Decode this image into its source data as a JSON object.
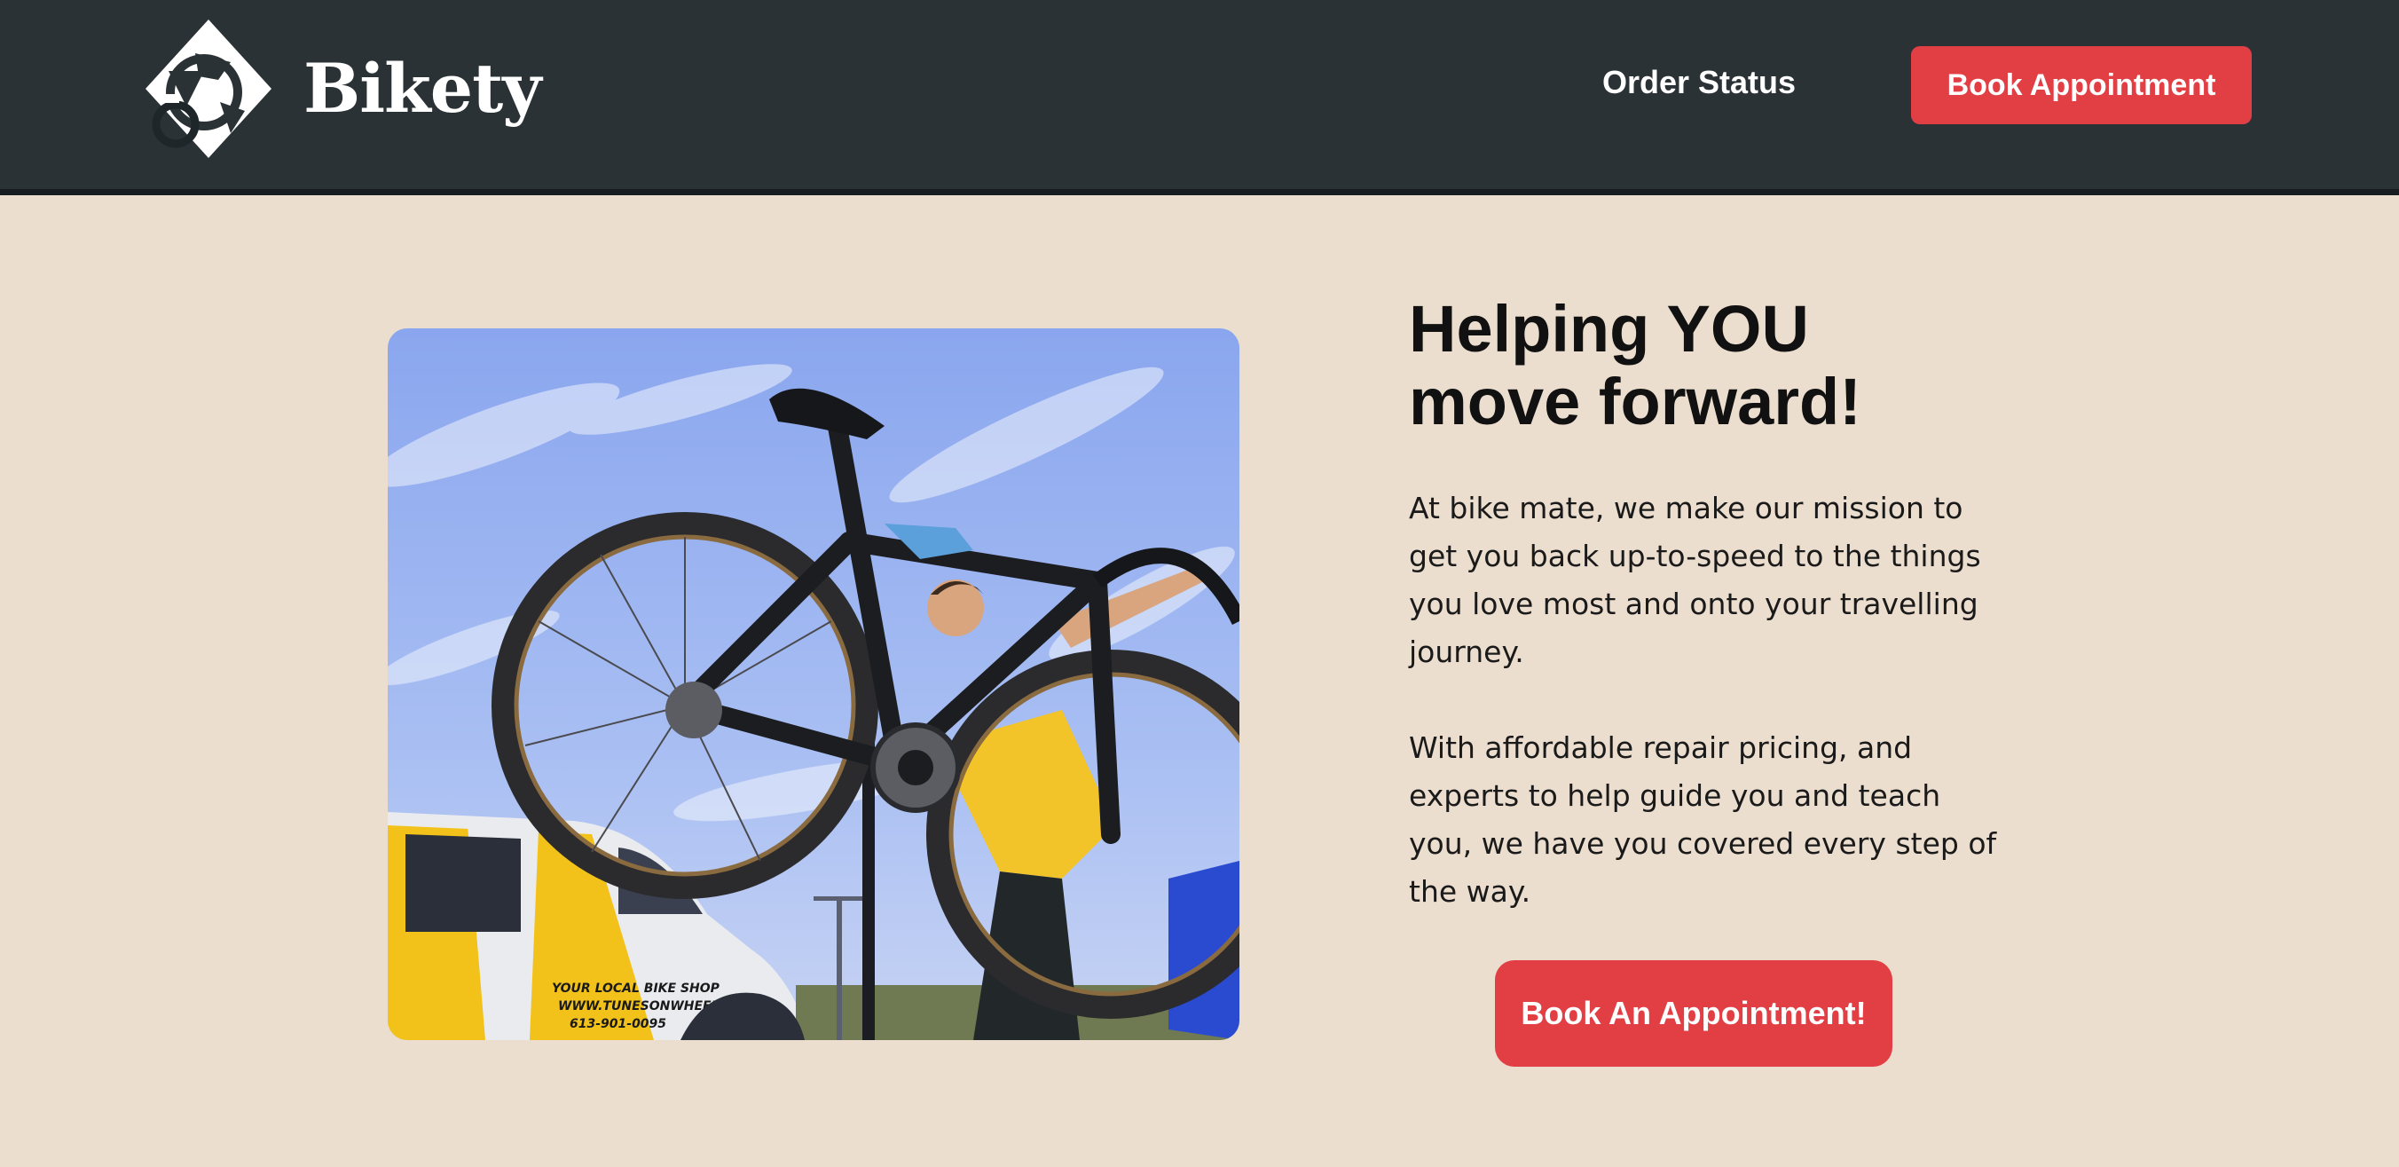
{
  "header": {
    "brand": "Bikety",
    "logo_icon": "bike-logo-icon",
    "nav_order_status": "Order Status",
    "nav_book": "Book Appointment"
  },
  "hero": {
    "title_line1": "Helping YOU",
    "title_line2": "move forward!",
    "para1_lines": [
      "At bike mate, we make our mission to",
      "get you back up-to-speed to the things",
      "you love most and onto your travelling",
      "journey."
    ],
    "para2_lines": [
      "With affordable repair pricing, and",
      "experts to help guide you and teach",
      "you, we have you covered every step of",
      "the way."
    ],
    "cta": "Book An Appointment!",
    "photo": {
      "van_line1": "YOUR LOCAL BIKE SHOP",
      "van_line2": "WWW.TUNESONWHEELS.CA",
      "van_line3": "613-901-0095"
    }
  },
  "colors": {
    "header_bg": "#2b3236",
    "page_bg": "#ecdecf",
    "accent": "#e23f45"
  }
}
